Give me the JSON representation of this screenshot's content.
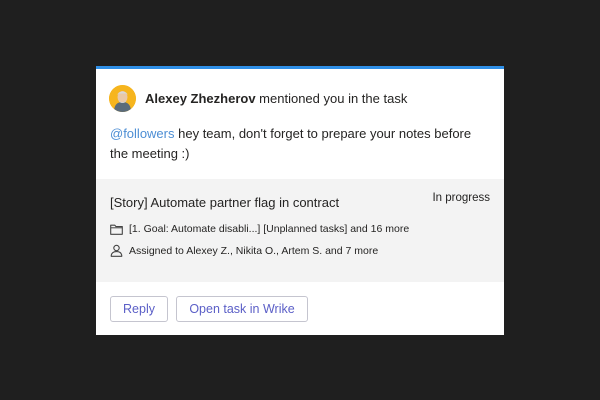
{
  "notification": {
    "author": "Alexey Zhezherov",
    "action": "mentioned you in the task",
    "mention": "@followers",
    "message_line1": "hey team, don't forget to prepare your notes before",
    "message_line2": "the meeting :)"
  },
  "task": {
    "title": "[Story] Automate partner flag in contract",
    "status": "In progress",
    "folders": "[1. Goal: Automate disabli...] [Unplanned tasks] and 16 more",
    "assigned": "Assigned to Alexey Z., Nikita O., Artem S. and 7 more"
  },
  "actions": {
    "reply_label": "Reply",
    "open_label": "Open task in Wrike"
  },
  "icons": {
    "folder": "folder-icon",
    "person": "person-icon"
  },
  "colors": {
    "accent_bar": "#2f8fe6",
    "mention": "#4d8ed4",
    "button_text": "#5b5fc7",
    "avatar_bg": "#f6b51e",
    "task_bg": "#f3f3f3"
  }
}
